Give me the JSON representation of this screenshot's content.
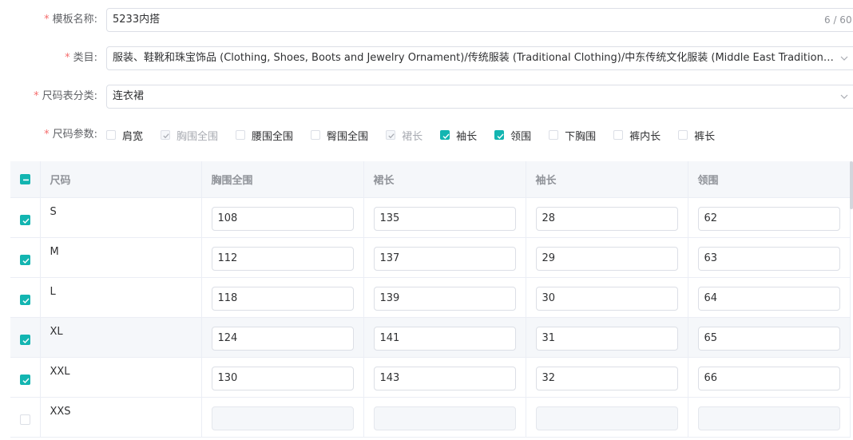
{
  "form": {
    "template_name": {
      "label": "模板名称:",
      "value": "5233内搭",
      "count": "6 / 60"
    },
    "category": {
      "label": "类目:",
      "value": "服装、鞋靴和珠宝饰品 (Clothing, Shoes, Boots and Jewelry Ornament)/传统服装 (Traditional Clothing)/中东传统文化服装 (Middle East Traditional ..."
    },
    "size_chart_type": {
      "label": "尺码表分类:",
      "value": "连衣裙"
    },
    "size_params": {
      "label": "尺码参数:",
      "options": [
        {
          "label": "肩宽",
          "state": "unchecked"
        },
        {
          "label": "胸围全围",
          "state": "checked-disabled"
        },
        {
          "label": "腰围全围",
          "state": "unchecked"
        },
        {
          "label": "臀围全围",
          "state": "unchecked"
        },
        {
          "label": "裙长",
          "state": "checked-disabled"
        },
        {
          "label": "袖长",
          "state": "checked"
        },
        {
          "label": "领围",
          "state": "checked"
        },
        {
          "label": "下胸围",
          "state": "unchecked"
        },
        {
          "label": "裤内长",
          "state": "unchecked"
        },
        {
          "label": "裤长",
          "state": "unchecked"
        }
      ]
    }
  },
  "table": {
    "headers": [
      "尺码",
      "胸围全围",
      "裙长",
      "袖长",
      "领围"
    ],
    "rows": [
      {
        "size": "S",
        "checked": true,
        "values": [
          "108",
          "135",
          "28",
          "62"
        ]
      },
      {
        "size": "M",
        "checked": true,
        "values": [
          "112",
          "137",
          "29",
          "63"
        ]
      },
      {
        "size": "L",
        "checked": true,
        "values": [
          "118",
          "139",
          "30",
          "64"
        ]
      },
      {
        "size": "XL",
        "checked": true,
        "values": [
          "124",
          "141",
          "31",
          "65"
        ],
        "highlighted": true
      },
      {
        "size": "XXL",
        "checked": true,
        "values": [
          "130",
          "143",
          "32",
          "66"
        ]
      },
      {
        "size": "XXS",
        "checked": false,
        "values": [
          "",
          "",
          "",
          ""
        ]
      }
    ]
  },
  "colors": {
    "accent": "#13b5b1",
    "required": "#f56c6c"
  },
  "icons": {
    "select_caret": "chevron-down-icon",
    "check": "check-icon",
    "indeterminate": "minus-icon"
  }
}
